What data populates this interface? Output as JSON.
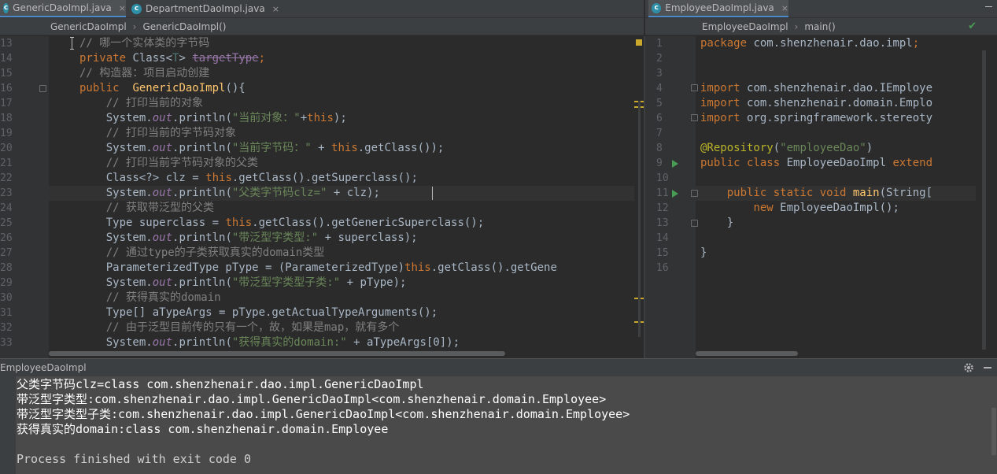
{
  "tabs_left": [
    {
      "label": "GenericDaoImpl.java",
      "active": true
    },
    {
      "label": "DepartmentDaoImpl.java",
      "active": false
    }
  ],
  "tabs_right": [
    {
      "label": "EmployeeDaoImpl.java",
      "active": true
    }
  ],
  "tab_close_glyph": "×",
  "file_icon_letter": "c",
  "breadcrumb_left": [
    "GenericDaoImpl",
    "GenericDaoImpl()"
  ],
  "breadcrumb_right": [
    "EmployeeDaoImpl",
    "main()"
  ],
  "breadcrumb_sep": "›",
  "left_editor": {
    "line_numbers": [
      "13",
      "14",
      "15",
      "16",
      "17",
      "18",
      "19",
      "20",
      "21",
      "22",
      "23",
      "24",
      "25",
      "26",
      "27",
      "28",
      "29",
      "30",
      "31",
      "32",
      "33"
    ],
    "lines": [
      [
        [
          "cm",
          "// 哪一个实体类的字节码"
        ]
      ],
      [
        [
          "kw",
          "private "
        ],
        [
          "",
          "Class<"
        ],
        [
          "tp",
          "T"
        ],
        [
          "",
          "> "
        ],
        [
          "strike",
          "targetType"
        ],
        [
          "kw",
          ";"
        ]
      ],
      [
        [
          "cm",
          "// 构造器：项目启动创建"
        ]
      ],
      [
        [
          "kw",
          "public  "
        ],
        [
          "fn",
          "GenericDaoImpl"
        ],
        [
          "",
          "(){"
        ]
      ],
      [
        [
          "",
          "    "
        ],
        [
          "cm",
          "// 打印当前的对象"
        ]
      ],
      [
        [
          "",
          "    System."
        ],
        [
          "fld it",
          "out"
        ],
        [
          "",
          ".println("
        ],
        [
          "str",
          "\"当前对象：\""
        ],
        [
          "",
          "+"
        ],
        [
          "kw",
          "this"
        ],
        [
          "",
          "); "
        ]
      ],
      [
        [
          "",
          "    "
        ],
        [
          "cm",
          "// 打印当前的字节码对象"
        ]
      ],
      [
        [
          "",
          "    System."
        ],
        [
          "fld it",
          "out"
        ],
        [
          "",
          ".println("
        ],
        [
          "str",
          "\"当前字节码：\""
        ],
        [
          "",
          " + "
        ],
        [
          "kw",
          "this"
        ],
        [
          "",
          ".getClass());"
        ]
      ],
      [
        [
          "",
          "    "
        ],
        [
          "cm",
          "// 打印当前字节码对象的父类"
        ]
      ],
      [
        [
          "",
          "    Class<?> clz = "
        ],
        [
          "kw",
          "this"
        ],
        [
          "",
          ".getClass().getSuperclass();"
        ]
      ],
      [
        [
          "",
          "    System."
        ],
        [
          "fld it",
          "out"
        ],
        [
          "",
          ".println("
        ],
        [
          "str",
          "\"父类字节码clz=\""
        ],
        [
          "",
          " + clz);"
        ]
      ],
      [
        [
          "",
          "    "
        ],
        [
          "cm",
          "// 获取带泛型的父类"
        ]
      ],
      [
        [
          "",
          "    Type superclass = "
        ],
        [
          "kw",
          "this"
        ],
        [
          "",
          ".getClass().getGenericSuperclass();"
        ]
      ],
      [
        [
          "",
          "    System."
        ],
        [
          "fld it",
          "out"
        ],
        [
          "",
          ".println("
        ],
        [
          "str",
          "\"带泛型字类型:\""
        ],
        [
          "",
          " + superclass);"
        ]
      ],
      [
        [
          "",
          "    "
        ],
        [
          "cm",
          "// 通过type的子类获取真实的domain类型"
        ]
      ],
      [
        [
          "",
          "    ParameterizedType pType = (ParameterizedType)"
        ],
        [
          "kw",
          "this"
        ],
        [
          "",
          ".getClass().getGene"
        ]
      ],
      [
        [
          "",
          "    System."
        ],
        [
          "fld it",
          "out"
        ],
        [
          "",
          ".println("
        ],
        [
          "str",
          "\"带泛型字类型子类:\""
        ],
        [
          "",
          " + pType);"
        ]
      ],
      [
        [
          "",
          "    "
        ],
        [
          "cm",
          "// 获得真实的domain"
        ]
      ],
      [
        [
          "",
          "    Type[] aTypeArgs = pType.getActualTypeArguments();"
        ]
      ],
      [
        [
          "",
          "    "
        ],
        [
          "cm",
          "// 由于泛型目前传的只有一个，故，如果是map，就有多个"
        ]
      ],
      [
        [
          "",
          "    System."
        ],
        [
          "fld it",
          "out"
        ],
        [
          "",
          ".println("
        ],
        [
          "str",
          "\"获得真实的domain:\""
        ],
        [
          "",
          " + aTypeArgs[0]);"
        ]
      ]
    ]
  },
  "right_editor": {
    "line_numbers": [
      "1",
      "2",
      "3",
      "4",
      "5",
      "6",
      "7",
      "8",
      "9",
      "10",
      "11",
      "12",
      "13",
      "14",
      "15",
      "16"
    ],
    "lines": [
      [
        [
          "kw",
          "package "
        ],
        [
          "",
          "com.shenzhenair.dao.impl"
        ],
        [
          "kw",
          ";"
        ]
      ],
      [],
      [],
      [
        [
          "kw",
          "import "
        ],
        [
          "",
          "com.shenzhenair.dao.IEmploye"
        ]
      ],
      [
        [
          "kw",
          "import "
        ],
        [
          "",
          "com.shenzhenair.domain.Emplo"
        ]
      ],
      [
        [
          "kw",
          "import "
        ],
        [
          "",
          "org.springframework.stereoty"
        ]
      ],
      [],
      [
        [
          "an",
          "@Repository"
        ],
        [
          "",
          "("
        ],
        [
          "str",
          "\"employeeDao\""
        ],
        [
          "",
          ")"
        ]
      ],
      [
        [
          "kw",
          "public class "
        ],
        [
          "",
          "EmployeeDaoImpl "
        ],
        [
          "kw",
          "extend"
        ]
      ],
      [],
      [
        [
          "",
          "    "
        ],
        [
          "kw",
          "public static void "
        ],
        [
          "fn",
          "main"
        ],
        [
          "",
          "(String["
        ]
      ],
      [
        [
          "",
          "        "
        ],
        [
          "kw",
          "new "
        ],
        [
          "",
          "EmployeeDaoImpl();"
        ]
      ],
      [
        [
          "",
          "    }"
        ]
      ],
      [],
      [
        [
          "",
          "}"
        ]
      ],
      []
    ]
  },
  "console": {
    "title": "EmployeeDaoImpl",
    "settings_icon": "gear-icon",
    "hide_icon": "minimize-icon",
    "lines": [
      "父类字节码clz=class com.shenzhenair.dao.impl.GenericDaoImpl",
      "带泛型字类型:com.shenzhenair.dao.impl.GenericDaoImpl<com.shenzhenair.domain.Employee>",
      "带泛型字类型子类:com.shenzhenair.dao.impl.GenericDaoImpl<com.shenzhenair.domain.Employee>",
      "获得真实的domain:class com.shenzhenair.domain.Employee",
      "",
      "Process finished with exit code 0"
    ]
  },
  "colors": {
    "editor_bg": "#2b2b2b",
    "keyword": "#cc7832",
    "string": "#6a8759",
    "comment": "#808080",
    "field": "#9876aa",
    "method_decl": "#ffc66d",
    "accent_tab": "#4a88c7"
  }
}
